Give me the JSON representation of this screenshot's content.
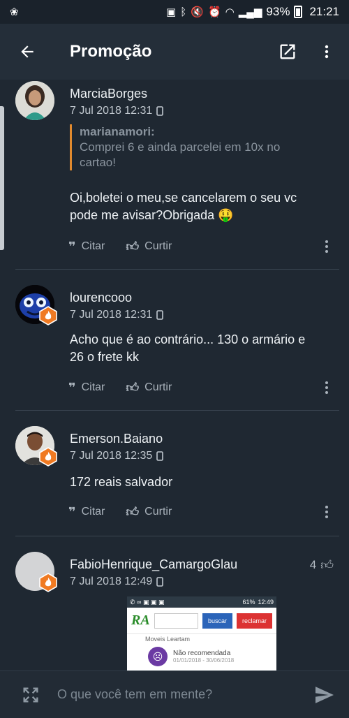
{
  "status_bar": {
    "battery": "93%",
    "time": "21:21"
  },
  "app_bar": {
    "title": "Promoção"
  },
  "comments": [
    {
      "username": "MarciaBorges",
      "timestamp": "7 Jul 2018 12:31",
      "quote": {
        "user": "marianamori:",
        "text": "Comprei 6 e ainda parcelei em 10x no cartao!"
      },
      "text": "Oi,boletei o meu,se cancelarem o seu vc pode me avisar?Obrigada 🤑",
      "cite_label": "Citar",
      "like_label": "Curtir"
    },
    {
      "username": "lourencooo",
      "timestamp": "7 Jul 2018 12:31",
      "text": "Acho que é ao contrário... 130 o armário e 26 o frete kk",
      "cite_label": "Citar",
      "like_label": "Curtir"
    },
    {
      "username": "Emerson.Baiano",
      "timestamp": "7 Jul 2018 12:35",
      "text": "172 reais salvador",
      "cite_label": "Citar",
      "like_label": "Curtir"
    },
    {
      "username": "FabioHenrique_CamargoGlau",
      "timestamp": "7 Jul 2018 12:49",
      "likes": "4",
      "attachment": {
        "status_battery": "61%",
        "status_time": "12:49",
        "logo": "RA",
        "buscar": "buscar",
        "reclamar": "reclamar",
        "subtitle": "Moveis Leartam",
        "rating": "Não recomendada",
        "period": "01/01/2018 - 30/06/2018"
      }
    }
  ],
  "composer": {
    "placeholder": "O que você tem em mente?"
  },
  "colors": {
    "background": "#1f2832",
    "app_bar": "#242e39",
    "quote_border": "#e28a2e",
    "badge": "#f07a22"
  }
}
